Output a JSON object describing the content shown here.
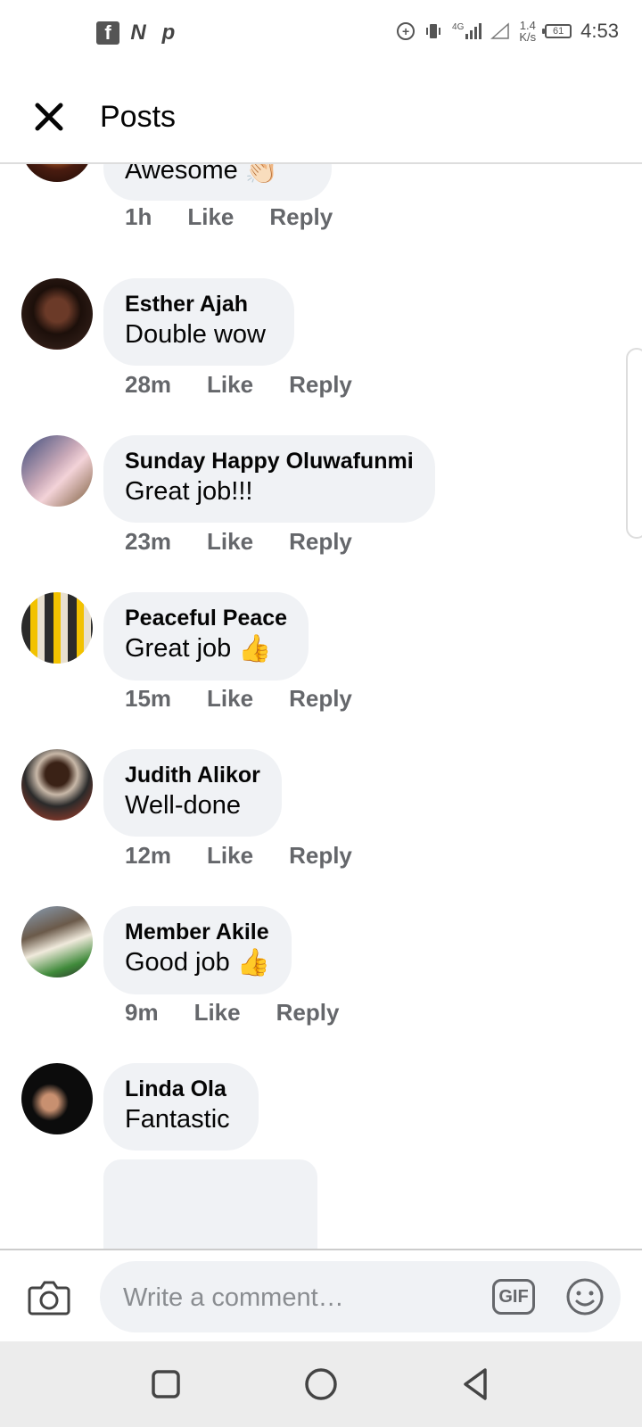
{
  "status_bar": {
    "apps": [
      "f",
      "N",
      "p"
    ],
    "network": "4G",
    "speed_top": "1.4",
    "speed_bottom": "K/s",
    "battery": "61",
    "time": "4:53"
  },
  "header": {
    "title": "Posts"
  },
  "comments": [
    {
      "name": "",
      "text": "Awesome",
      "emoji": "👏🏻",
      "time": "1h",
      "like": "Like",
      "reply": "Reply"
    },
    {
      "name": "Esther Ajah",
      "text": "Double wow",
      "emoji": "",
      "time": "28m",
      "like": "Like",
      "reply": "Reply"
    },
    {
      "name": "Sunday Happy Oluwafunmi",
      "text": "Great job!!!",
      "emoji": "",
      "time": "23m",
      "like": "Like",
      "reply": "Reply"
    },
    {
      "name": "Peaceful Peace",
      "text": "Great job",
      "emoji": "👍",
      "time": "15m",
      "like": "Like",
      "reply": "Reply"
    },
    {
      "name": "Judith Alikor",
      "text": "Well-done",
      "emoji": "",
      "time": "12m",
      "like": "Like",
      "reply": "Reply"
    },
    {
      "name": "Member Akile",
      "text": "Good job",
      "emoji": "👍",
      "time": "9m",
      "like": "Like",
      "reply": "Reply"
    },
    {
      "name": "Linda Ola",
      "text": "Fantastic",
      "emoji": "",
      "time": "",
      "like": "",
      "reply": ""
    }
  ],
  "composer": {
    "placeholder": "Write a comment…",
    "gif_label": "GIF"
  },
  "colors": {
    "bubble": "#f0f2f5",
    "meta_text": "#65676b",
    "nav_bg": "#ececec"
  }
}
